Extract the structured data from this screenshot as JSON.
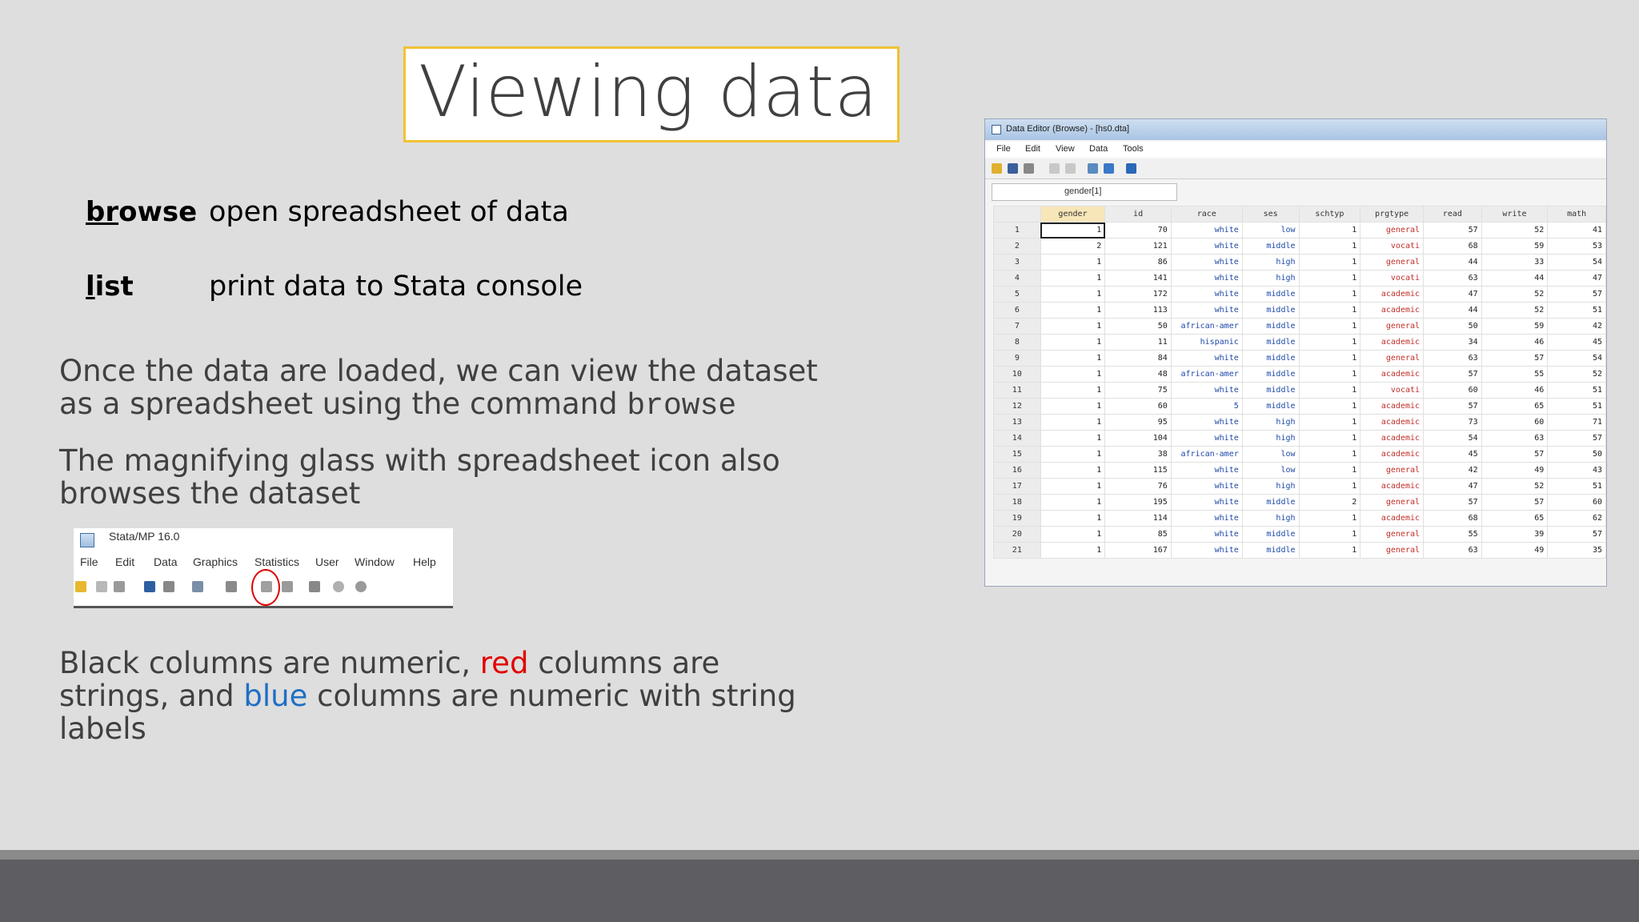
{
  "title": "Viewing data",
  "commands": [
    {
      "name_ul": "br",
      "name_rest": "owse",
      "desc": "open spreadsheet of data"
    },
    {
      "name_ul": "l",
      "name_rest": "ist",
      "desc": "print data to Stata console"
    }
  ],
  "para1": {
    "line1": "Once the data are loaded, we can view the dataset",
    "line2_prefix": "as a spreadsheet using the command ",
    "line2_code": "browse"
  },
  "para2": {
    "line1": "The magnifying glass with spreadsheet icon also",
    "line2": "browses the dataset"
  },
  "stata_window": {
    "title": "Stata/MP 16.0",
    "menu": [
      "File",
      "Edit",
      "Data",
      "Graphics",
      "Statistics",
      "User",
      "Window",
      "Help"
    ]
  },
  "para3": {
    "part1": "Black columns are numeric, ",
    "red_word": "red",
    "part2": " columns are",
    "part3": "strings, and ",
    "blue_word": "blue",
    "part4": " columns are numeric with string",
    "part5": "labels"
  },
  "colors": {
    "red": "#e00000",
    "blue": "#1f6fc5",
    "title_border": "#f1c232"
  },
  "data_editor": {
    "title": "Data Editor (Browse) - [hs0.dta]",
    "menu": [
      "File",
      "Edit",
      "View",
      "Data",
      "Tools"
    ],
    "cell_ref": "gender[1]",
    "columns": [
      "gender",
      "id",
      "race",
      "ses",
      "schtyp",
      "prgtype",
      "read",
      "write",
      "math"
    ],
    "column_types": [
      "num",
      "num",
      "lbl",
      "lbl",
      "num",
      "str",
      "num",
      "num",
      "num"
    ],
    "rows": [
      [
        "1",
        "1",
        "70",
        "white",
        "low",
        "1",
        "general",
        "57",
        "52",
        "41"
      ],
      [
        "2",
        "2",
        "121",
        "white",
        "middle",
        "1",
        "vocati",
        "68",
        "59",
        "53"
      ],
      [
        "3",
        "1",
        "86",
        "white",
        "high",
        "1",
        "general",
        "44",
        "33",
        "54"
      ],
      [
        "4",
        "1",
        "141",
        "white",
        "high",
        "1",
        "vocati",
        "63",
        "44",
        "47"
      ],
      [
        "5",
        "1",
        "172",
        "white",
        "middle",
        "1",
        "academic",
        "47",
        "52",
        "57"
      ],
      [
        "6",
        "1",
        "113",
        "white",
        "middle",
        "1",
        "academic",
        "44",
        "52",
        "51"
      ],
      [
        "7",
        "1",
        "50",
        "african-amer",
        "middle",
        "1",
        "general",
        "50",
        "59",
        "42"
      ],
      [
        "8",
        "1",
        "11",
        "hispanic",
        "middle",
        "1",
        "academic",
        "34",
        "46",
        "45"
      ],
      [
        "9",
        "1",
        "84",
        "white",
        "middle",
        "1",
        "general",
        "63",
        "57",
        "54"
      ],
      [
        "10",
        "1",
        "48",
        "african-amer",
        "middle",
        "1",
        "academic",
        "57",
        "55",
        "52"
      ],
      [
        "11",
        "1",
        "75",
        "white",
        "middle",
        "1",
        "vocati",
        "60",
        "46",
        "51"
      ],
      [
        "12",
        "1",
        "60",
        "5",
        "middle",
        "1",
        "academic",
        "57",
        "65",
        "51"
      ],
      [
        "13",
        "1",
        "95",
        "white",
        "high",
        "1",
        "academic",
        "73",
        "60",
        "71"
      ],
      [
        "14",
        "1",
        "104",
        "white",
        "high",
        "1",
        "academic",
        "54",
        "63",
        "57"
      ],
      [
        "15",
        "1",
        "38",
        "african-amer",
        "low",
        "1",
        "academic",
        "45",
        "57",
        "50"
      ],
      [
        "16",
        "1",
        "115",
        "white",
        "low",
        "1",
        "general",
        "42",
        "49",
        "43"
      ],
      [
        "17",
        "1",
        "76",
        "white",
        "high",
        "1",
        "academic",
        "47",
        "52",
        "51"
      ],
      [
        "18",
        "1",
        "195",
        "white",
        "middle",
        "2",
        "general",
        "57",
        "57",
        "60"
      ],
      [
        "19",
        "1",
        "114",
        "white",
        "high",
        "1",
        "academic",
        "68",
        "65",
        "62"
      ],
      [
        "20",
        "1",
        "85",
        "white",
        "middle",
        "1",
        "general",
        "55",
        "39",
        "57"
      ],
      [
        "21",
        "1",
        "167",
        "white",
        "middle",
        "1",
        "general",
        "63",
        "49",
        "35"
      ]
    ]
  }
}
